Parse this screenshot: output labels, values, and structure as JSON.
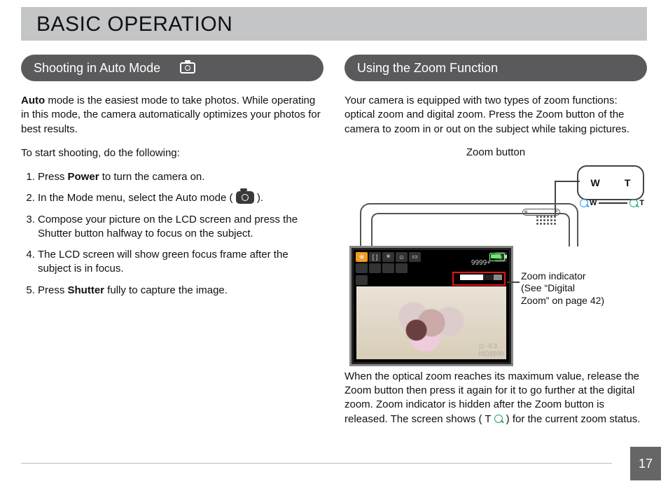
{
  "header": {
    "title": "BASIC OPERATION"
  },
  "left": {
    "pill": "Shooting in Auto Mode",
    "intro_pre": "Auto",
    "intro_post": " mode is the easiest mode to take photos. While operating in this mode, the camera automatically optimizes your photos for best results.",
    "lead": "To start shooting, do the following:",
    "steps": {
      "s1a": "Press ",
      "s1b": "Power",
      "s1c": " to turn the camera on.",
      "s2a": "In the Mode menu, select the Auto mode (",
      "s2b": ").",
      "s3": "Compose your picture on the LCD screen and press the Shutter button halfway to focus on the subject.",
      "s4": "The LCD screen will show green focus frame after the subject is in focus.",
      "s5a": "Press ",
      "s5b": "Shutter",
      "s5c": " fully to capture the image."
    }
  },
  "right": {
    "pill": "Using the Zoom Function",
    "intro": "Your camera is equipped with two types of zoom functions: optical zoom and digital zoom. Press the Zoom button of the camera to zoom in or out on the subject while taking pictures.",
    "zoom_button_label": "Zoom button",
    "detail_w": "W",
    "detail_t": "T",
    "wt_w": "W",
    "wt_t": "T",
    "lcd": {
      "counter": "9999+",
      "ev": "-0.3",
      "iso": "ISO1600"
    },
    "zoom_indicator_label": "Zoom indicator (See “Digital Zoom” on page 42)",
    "outro_a": "When the optical zoom reaches its maximum value, release the Zoom button then press it again for it to go further at the digital zoom. Zoom indicator is hidden after the Zoom button is released. The screen shows (",
    "outro_t": "T",
    "outro_b": ") for the current zoom status."
  },
  "page_number": "17"
}
